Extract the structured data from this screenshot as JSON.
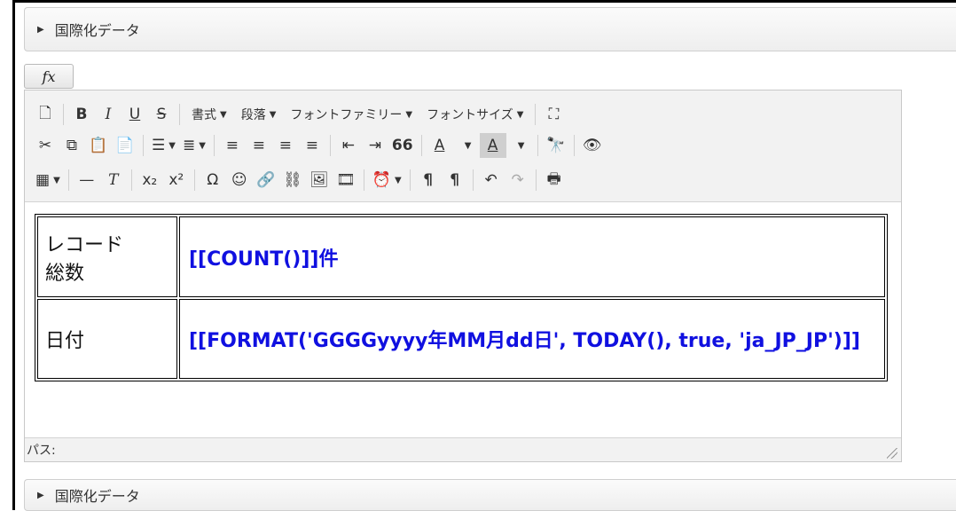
{
  "sections": {
    "top_header": "国際化データ",
    "bottom_header": "国際化データ"
  },
  "fx_button": "fx",
  "toolbar": {
    "row1": {
      "bold": "B",
      "italic": "I",
      "underline": "U",
      "strike": "S",
      "format": "書式",
      "paragraph": "段落",
      "font_family": "フォントファミリー",
      "font_size": "フォントサイズ"
    },
    "row2": {
      "quote": "66",
      "text_color": "A",
      "bg_color": "A"
    },
    "row3": {
      "omega": "Ω",
      "pilcrow": "¶",
      "pilcrow_rtl": "¶"
    }
  },
  "content": {
    "rows": [
      {
        "label": "レコード\n総数",
        "value": "[[COUNT()]]件"
      },
      {
        "label": "日付",
        "value": "[[FORMAT('GGGGyyyy年MM月dd日', TODAY(), true, 'ja_JP_JP')]]"
      }
    ]
  },
  "statusbar": {
    "path_label": "パス:"
  },
  "colors": {
    "formula_text": "#1010e0"
  }
}
